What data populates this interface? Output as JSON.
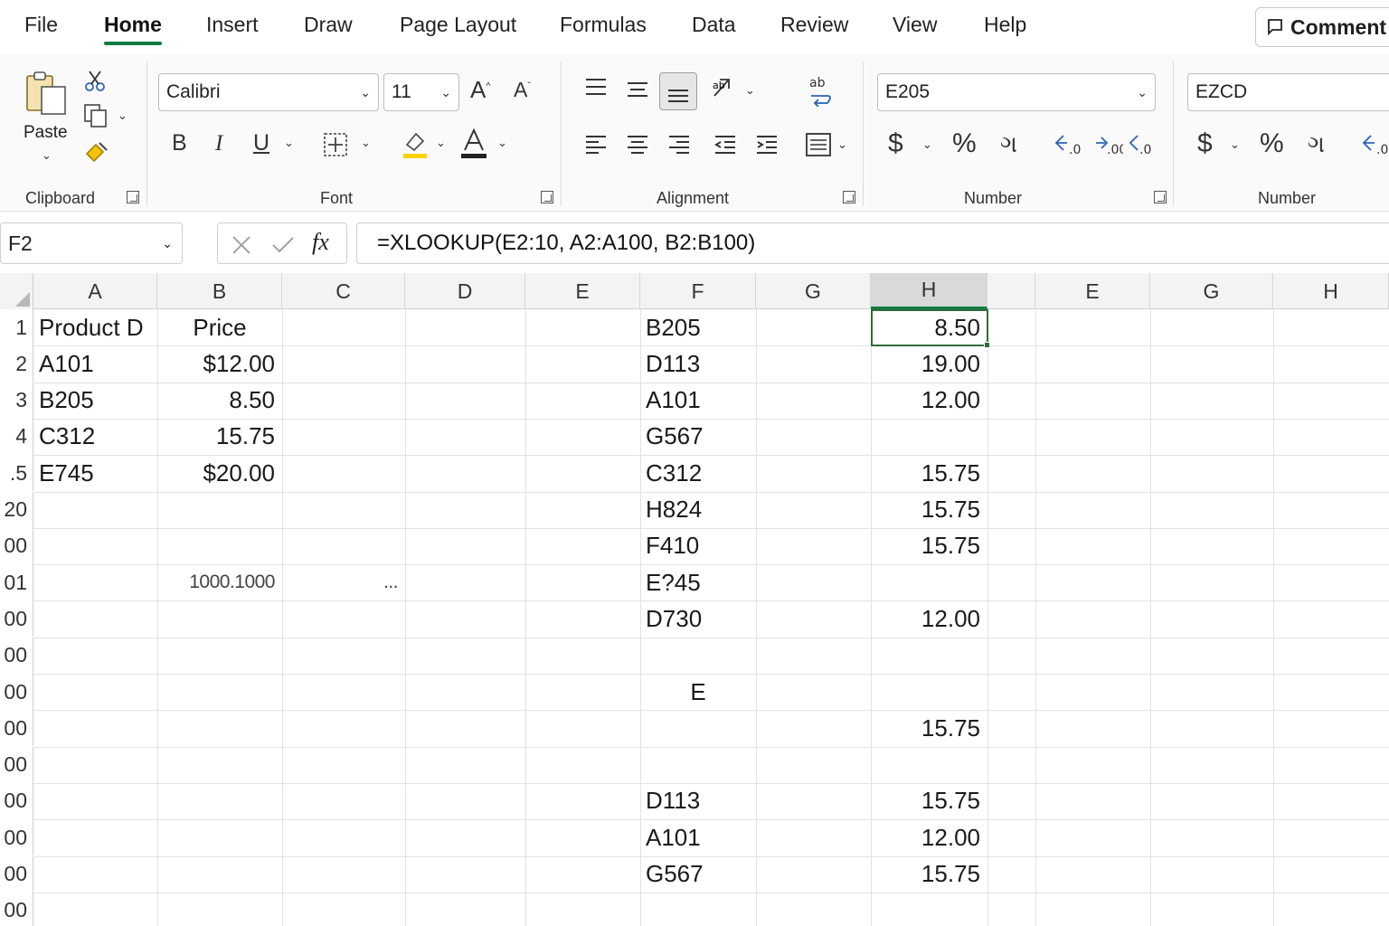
{
  "menu": {
    "items": [
      "File",
      "Home",
      "Insert",
      "Draw",
      "Page Layout",
      "Formulas",
      "Data",
      "Review",
      "View",
      "Help"
    ],
    "active": "Home",
    "comment_label": "Comment"
  },
  "ribbon": {
    "clipboard": {
      "label": "Clipboard",
      "paste_label": "Paste"
    },
    "font": {
      "label": "Font",
      "font_name": "Calibri",
      "font_size": "11",
      "bold": "B",
      "italic": "I",
      "underline": "U",
      "grow": "A",
      "shrink": "A"
    },
    "alignment": {
      "label": "Alignment"
    },
    "number1": {
      "label": "Number",
      "format_value": "E205",
      "currency": "$",
      "percent": "%",
      "comma": "ગ"
    },
    "number2": {
      "label": "Number",
      "format_value": "EZCD",
      "currency": "$",
      "percent": "%",
      "comma": "ગ"
    },
    "accent_color": "#107c41"
  },
  "formula_bar": {
    "name_box": "F2",
    "fx": "fx",
    "formula": "=XLOOKUP(E2:10, A2:A100, B2:B100)"
  },
  "grid": {
    "columns": [
      "A",
      "B",
      "C",
      "D",
      "E",
      "F",
      "G",
      "H",
      "E",
      "G",
      "H"
    ],
    "selected_column_index": 7,
    "row_labels": [
      "1",
      "2",
      "3",
      "4",
      ".5",
      "20",
      "00",
      "01",
      "00",
      "00",
      "00",
      "00",
      "00",
      "00",
      "00",
      "00",
      "00"
    ],
    "cells": {
      "a": [
        "Product D",
        "A101",
        "B205",
        "C312",
        "E745"
      ],
      "b": [
        "Price",
        "$12.00",
        "8.50",
        "15.75",
        "$20.00"
      ],
      "b_row8": "1000.1000",
      "c_row8": "...",
      "f": [
        "B205",
        "D113",
        "A101",
        "G567",
        "C312",
        "H824",
        "F410",
        "E?45",
        "D730",
        "",
        "E",
        "",
        "",
        "D113",
        "A101",
        "G567"
      ],
      "h": [
        "8.50",
        "19.00",
        "12.00",
        "",
        "15.75",
        "15.75",
        "15.75",
        "",
        "12.00",
        "",
        "",
        "15.75",
        "",
        "15.75",
        "12.00",
        "15.75"
      ]
    }
  }
}
